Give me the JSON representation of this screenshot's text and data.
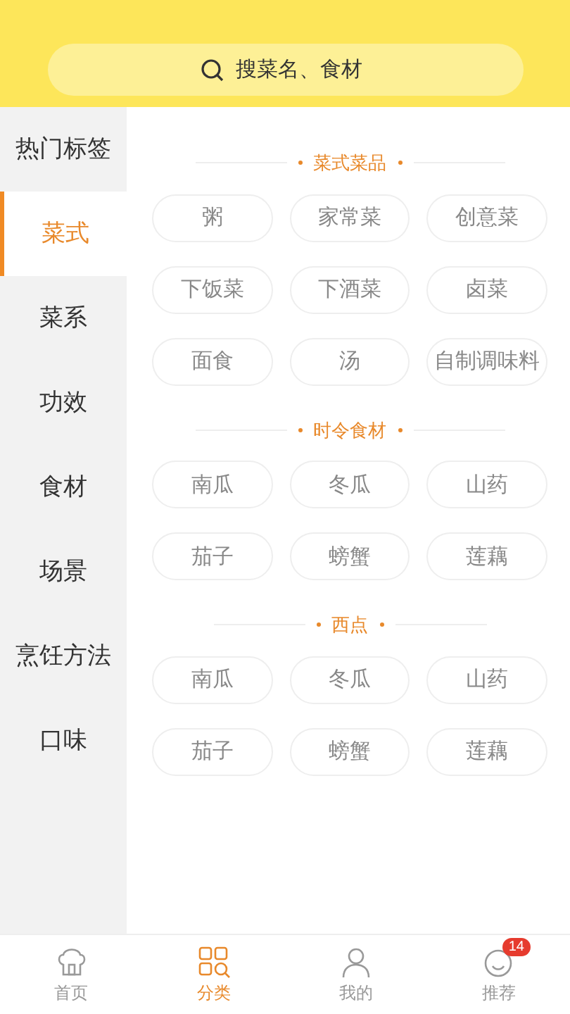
{
  "search": {
    "placeholder": "搜菜名、食材"
  },
  "sidebar": {
    "items": [
      {
        "label": "热门标签",
        "selected": false
      },
      {
        "label": "菜式",
        "selected": true
      },
      {
        "label": "菜系",
        "selected": false
      },
      {
        "label": "功效",
        "selected": false
      },
      {
        "label": "食材",
        "selected": false
      },
      {
        "label": "场景",
        "selected": false
      },
      {
        "label": "烹饪方法",
        "selected": false
      },
      {
        "label": "口味",
        "selected": false
      }
    ]
  },
  "sections": [
    {
      "title": "菜式菜品",
      "tags": [
        "粥",
        "家常菜",
        "创意菜",
        "下饭菜",
        "下酒菜",
        "卤菜",
        "面食",
        "汤",
        "自制调味料"
      ]
    },
    {
      "title": "时令食材",
      "tags": [
        "南瓜",
        "冬瓜",
        "山药",
        "茄子",
        "螃蟹",
        "莲藕"
      ]
    },
    {
      "title": "西点",
      "tags": [
        "南瓜",
        "冬瓜",
        "山药",
        "茄子",
        "螃蟹",
        "莲藕"
      ]
    }
  ],
  "tabbar": [
    {
      "label": "首页",
      "selected": false
    },
    {
      "label": "分类",
      "selected": true
    },
    {
      "label": "我的",
      "selected": false
    },
    {
      "label": "推荐",
      "selected": false,
      "badge": "14"
    }
  ]
}
